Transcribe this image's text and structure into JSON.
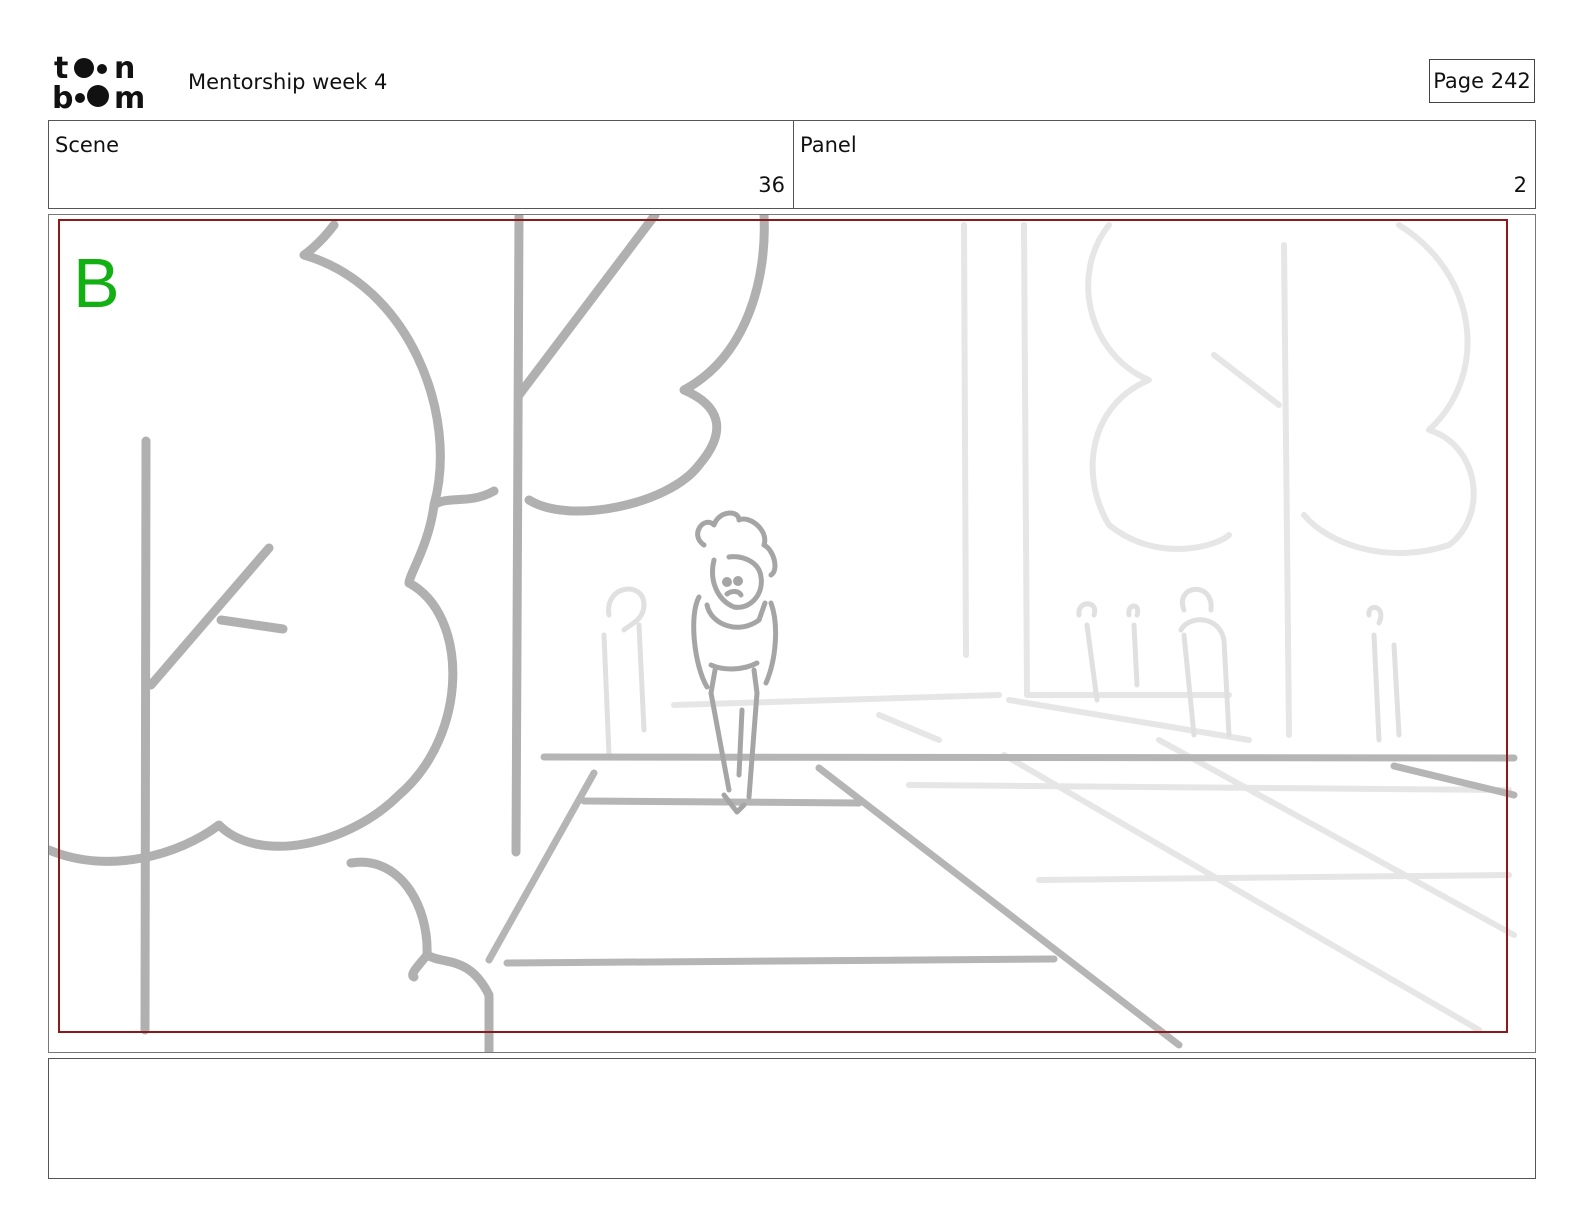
{
  "header": {
    "logo_text": "toon boom",
    "title": "Mentorship week 4",
    "page": "Page 242"
  },
  "scene": {
    "label": "Scene",
    "value": "36"
  },
  "panel": {
    "label": "Panel",
    "value": "2"
  },
  "frame": {
    "layer_label": "B",
    "layer_label_color": "#13b013",
    "safe_area_color": "#8b1a1a"
  },
  "notes": {
    "text": ""
  }
}
